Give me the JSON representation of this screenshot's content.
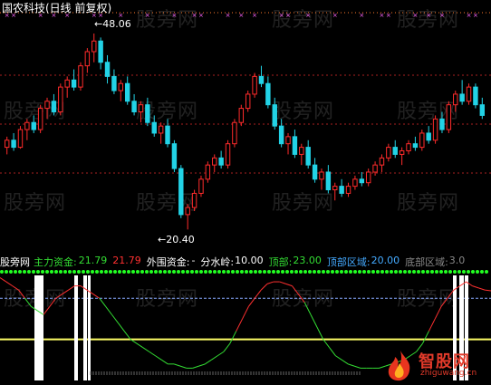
{
  "header": {
    "title": "国农科技(日线 前复权)"
  },
  "watermark": {
    "text": "股旁网"
  },
  "annotations": {
    "high_label": "48.06",
    "low_label": "20.40",
    "high_arrow": "←",
    "low_arrow": "←"
  },
  "indicator_bar": {
    "name": "股旁网",
    "main_fund_label": "主力资金:",
    "main_fund_value": "21.79",
    "main_fund_value2": "21.79",
    "foreign_fund_label": "外围资金:",
    "foreign_fund_value": "-",
    "watershed_label": "分水岭:",
    "watershed_value": "10.00",
    "top_label": "顶部:",
    "top_value": "23.00",
    "top_zone_label": "顶部区域:",
    "top_zone_value": "20.00",
    "bottom_zone_label": "底部区域:",
    "bottom_zone_value": "3.0"
  },
  "logo": {
    "main": "智股网",
    "sub": "zhiguwang.cn"
  },
  "colors": {
    "up": "#ff2b2b",
    "down": "#22d3e6",
    "ma_dots": "#ff7a2b",
    "pink_marks": "#ff66ff",
    "indicator_red": "#ff3030",
    "indicator_green": "#33dd33",
    "watershed_line": "#ffff66",
    "top_line": "#88aaff",
    "dotted_green": "#22ff22",
    "white_bars": "#ffffff"
  },
  "chart_data": [
    {
      "type": "line",
      "title": "国农科技(日线 前复权)",
      "subtype": "candlestick",
      "ylim": [
        17.5,
        51
      ],
      "highest": 48.06,
      "lowest": 20.4,
      "candles": [
        [
          32.0,
          33.5,
          31.0,
          33.0
        ],
        [
          33.0,
          34.0,
          31.5,
          32.0
        ],
        [
          32.0,
          35.0,
          31.8,
          34.5
        ],
        [
          34.5,
          36.0,
          33.0,
          35.5
        ],
        [
          35.5,
          36.5,
          34.0,
          34.5
        ],
        [
          34.5,
          38.0,
          34.0,
          37.5
        ],
        [
          37.5,
          39.0,
          36.0,
          38.5
        ],
        [
          38.5,
          39.5,
          36.5,
          37.0
        ],
        [
          37.0,
          41.0,
          36.5,
          40.5
        ],
        [
          40.5,
          42.0,
          39.0,
          41.5
        ],
        [
          41.5,
          43.0,
          40.0,
          40.5
        ],
        [
          40.5,
          44.0,
          40.0,
          43.5
        ],
        [
          43.5,
          46.0,
          42.5,
          45.5
        ],
        [
          45.5,
          48.06,
          44.0,
          47.0
        ],
        [
          47.0,
          47.5,
          43.0,
          44.0
        ],
        [
          44.0,
          45.0,
          41.0,
          42.0
        ],
        [
          42.0,
          43.0,
          39.5,
          40.0
        ],
        [
          40.0,
          41.5,
          38.5,
          41.0
        ],
        [
          41.0,
          42.0,
          38.0,
          38.5
        ],
        [
          38.5,
          39.5,
          36.5,
          37.0
        ],
        [
          37.0,
          38.5,
          35.5,
          38.0
        ],
        [
          38.0,
          39.0,
          35.0,
          35.5
        ],
        [
          35.5,
          36.5,
          33.5,
          34.0
        ],
        [
          34.0,
          35.5,
          32.5,
          35.0
        ],
        [
          35.0,
          36.0,
          32.0,
          32.5
        ],
        [
          32.5,
          33.0,
          28.5,
          29.0
        ],
        [
          29.0,
          29.5,
          22.0,
          22.5
        ],
        [
          22.5,
          24.0,
          20.4,
          23.5
        ],
        [
          23.5,
          26.0,
          23.0,
          25.5
        ],
        [
          25.5,
          28.0,
          25.0,
          27.5
        ],
        [
          27.5,
          30.0,
          27.0,
          29.5
        ],
        [
          29.5,
          31.0,
          28.5,
          30.5
        ],
        [
          30.5,
          31.5,
          29.0,
          29.5
        ],
        [
          29.5,
          33.0,
          29.0,
          32.5
        ],
        [
          32.5,
          36.0,
          32.0,
          35.5
        ],
        [
          35.5,
          38.0,
          35.0,
          37.5
        ],
        [
          37.5,
          40.0,
          37.0,
          39.5
        ],
        [
          39.5,
          42.5,
          39.0,
          42.0
        ],
        [
          42.0,
          43.5,
          40.5,
          41.0
        ],
        [
          41.0,
          42.0,
          37.5,
          38.0
        ],
        [
          38.0,
          39.0,
          34.5,
          35.0
        ],
        [
          35.0,
          36.0,
          32.0,
          32.5
        ],
        [
          32.5,
          34.0,
          31.0,
          33.5
        ],
        [
          33.5,
          34.5,
          30.5,
          31.0
        ],
        [
          31.0,
          32.5,
          29.5,
          32.0
        ],
        [
          32.0,
          33.0,
          29.0,
          29.5
        ],
        [
          29.5,
          30.5,
          27.0,
          27.5
        ],
        [
          27.5,
          29.0,
          26.0,
          28.5
        ],
        [
          28.5,
          29.5,
          25.5,
          26.0
        ],
        [
          26.0,
          27.0,
          24.5,
          26.5
        ],
        [
          26.5,
          27.5,
          25.0,
          25.5
        ],
        [
          25.5,
          27.0,
          25.0,
          26.5
        ],
        [
          26.5,
          28.0,
          26.0,
          27.5
        ],
        [
          27.5,
          28.5,
          26.5,
          27.0
        ],
        [
          27.0,
          29.0,
          26.5,
          28.5
        ],
        [
          28.5,
          30.0,
          28.0,
          29.5
        ],
        [
          29.5,
          31.0,
          28.5,
          30.5
        ],
        [
          30.5,
          32.5,
          30.0,
          32.0
        ],
        [
          32.0,
          33.0,
          30.5,
          31.0
        ],
        [
          31.0,
          32.0,
          29.5,
          31.5
        ],
        [
          31.5,
          33.0,
          31.0,
          32.5
        ],
        [
          32.5,
          33.5,
          31.5,
          32.0
        ],
        [
          32.0,
          34.5,
          31.5,
          34.0
        ],
        [
          34.0,
          35.0,
          32.5,
          33.0
        ],
        [
          33.0,
          36.5,
          32.5,
          36.0
        ],
        [
          36.0,
          37.0,
          34.0,
          34.5
        ],
        [
          34.5,
          38.5,
          34.0,
          38.0
        ],
        [
          38.0,
          40.0,
          37.0,
          39.5
        ],
        [
          39.5,
          41.5,
          38.0,
          38.5
        ],
        [
          38.5,
          41.0,
          38.0,
          40.5
        ],
        [
          40.5,
          41.0,
          37.5,
          38.0
        ],
        [
          38.0,
          39.0,
          36.0,
          36.5
        ]
      ]
    },
    {
      "type": "line",
      "series": [
        {
          "name": "主力资金",
          "values": [
            25,
            24,
            23,
            22,
            20,
            18,
            17,
            16,
            18,
            20,
            21,
            22,
            23,
            23,
            22,
            21,
            20,
            18,
            16,
            14,
            12,
            10,
            9,
            8,
            7,
            6,
            5,
            4,
            4,
            3.5,
            3,
            3,
            3.5,
            4,
            5,
            6,
            7,
            9,
            12,
            15,
            18,
            20,
            22,
            23.5,
            24,
            24,
            23.5,
            23,
            21,
            19,
            16,
            13,
            10,
            8,
            6,
            5,
            4,
            3.5,
            3,
            3,
            3,
            3,
            3.5,
            4,
            4.5,
            5,
            6,
            7,
            9,
            12,
            15,
            18,
            20,
            22,
            23,
            24,
            23,
            22.5,
            22,
            21.8
          ]
        }
      ],
      "levels": {
        "分水岭": 10.0,
        "顶部": 23.0,
        "顶部区域": 20.0,
        "底部区域": 3.0
      },
      "ylim": [
        0,
        26
      ]
    }
  ]
}
